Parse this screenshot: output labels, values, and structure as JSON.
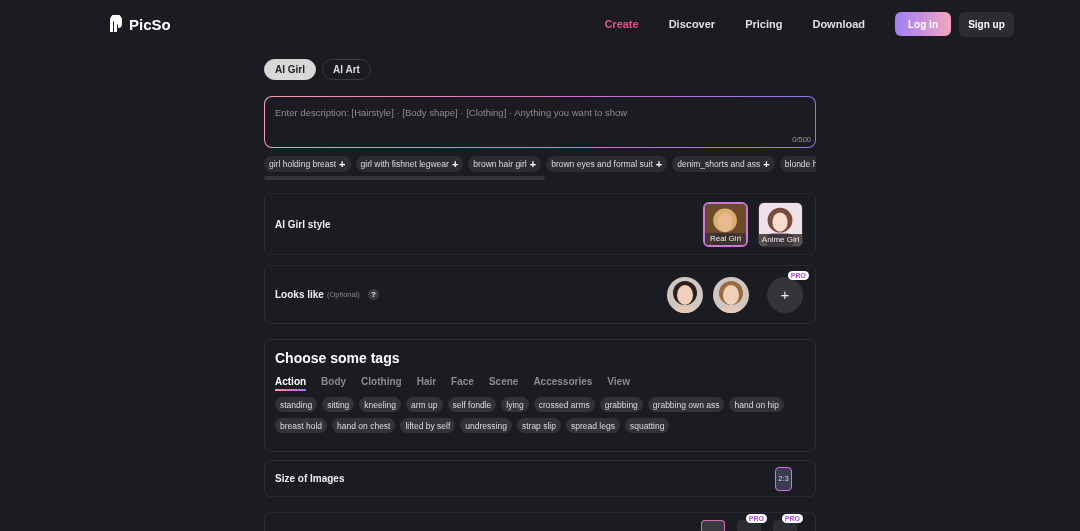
{
  "nav": {
    "logo": "PicSo",
    "links": [
      {
        "label": "Create",
        "selected": true
      },
      {
        "label": "Discover",
        "selected": false
      },
      {
        "label": "Pricing",
        "selected": false
      },
      {
        "label": "Download",
        "selected": false
      }
    ],
    "login": "Log in",
    "signup": "Sign up"
  },
  "mode_tabs": [
    {
      "label": "AI Girl",
      "selected": true
    },
    {
      "label": "AI Art",
      "selected": false
    }
  ],
  "prompt": {
    "placeholder": "Enter description: [Hairstyle] · [Body shape] · [Clothing] · Anything you want to show",
    "counter": "0/500"
  },
  "suggestions": [
    {
      "label": "girl holding breast",
      "icon": "+"
    },
    {
      "label": "girl with fishnet legwear",
      "icon": "+"
    },
    {
      "label": "brown hair girl",
      "icon": "+"
    },
    {
      "label": "brown eyes and formal suit",
      "icon": "+"
    },
    {
      "label": "denim_shorts and ass",
      "icon": "+"
    },
    {
      "label": "blonde h"
    }
  ],
  "style_card": {
    "title": "AI Girl style",
    "options": [
      {
        "label": "Real Girl",
        "selected": true
      },
      {
        "label": "Anime Girl",
        "selected": false
      }
    ]
  },
  "looks_like": {
    "title": "Looks like",
    "hint": "(Optional)",
    "help": "?",
    "add": "+",
    "badge": "PRO"
  },
  "tags_card": {
    "title": "Choose some tags",
    "categories": [
      {
        "label": "Action",
        "selected": true
      },
      {
        "label": "Body",
        "selected": false
      },
      {
        "label": "Clothing",
        "selected": false
      },
      {
        "label": "Hair",
        "selected": false
      },
      {
        "label": "Face",
        "selected": false
      },
      {
        "label": "Scene",
        "selected": false
      },
      {
        "label": "Accessories",
        "selected": false
      },
      {
        "label": "View",
        "selected": false
      }
    ],
    "tags": [
      "standing",
      "sitting",
      "kneeling",
      "arm up",
      "self fondle",
      "lying",
      "crossed arms",
      "grabbing",
      "grabbing own ass",
      "hand on hip",
      "breast hold",
      "hand on chest",
      "lifted by self",
      "undressing",
      "strap slip",
      "spread legs",
      "squatting"
    ]
  },
  "size_card": {
    "title": "Size of Images",
    "options": [
      {
        "label": "2:3",
        "selected": true
      }
    ]
  },
  "number_card": {
    "options": [
      {
        "selected": true
      },
      {
        "selected": false,
        "badge": "PRO"
      },
      {
        "selected": false,
        "badge": "PRO"
      }
    ]
  }
}
